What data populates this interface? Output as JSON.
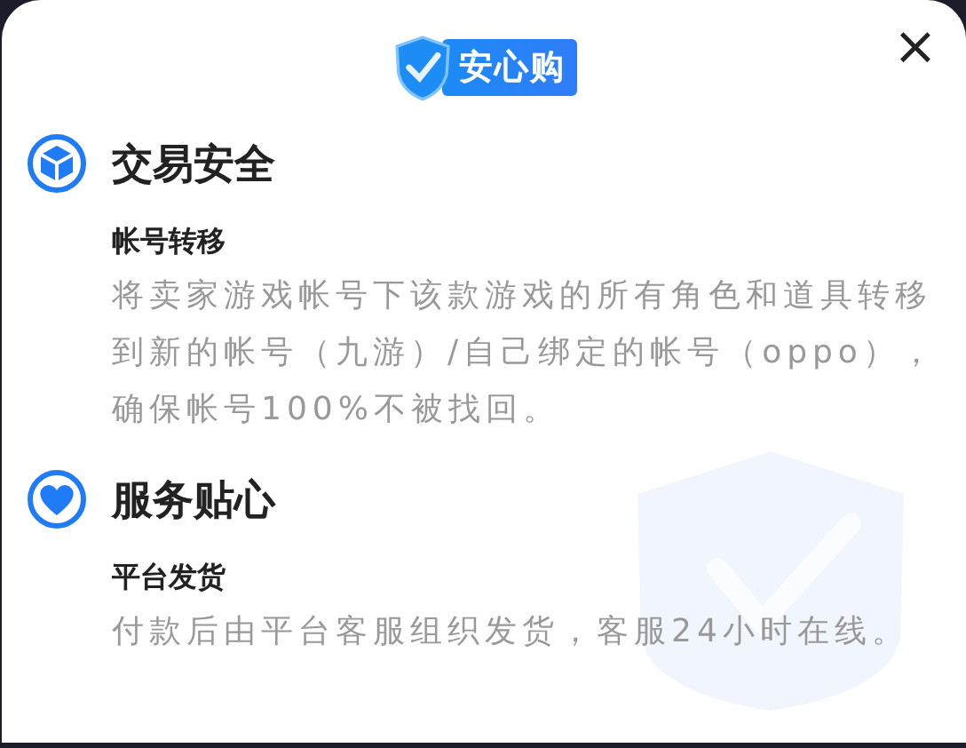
{
  "header": {
    "badge": "安心购",
    "close": "×"
  },
  "sections": [
    {
      "kind": "cube",
      "title": "交易安全",
      "subtitle": "帐号转移",
      "description": "将卖家游戏帐号下该款游戏的所有角色和道具转移到新的帐号（九游）/自己绑定的帐号（oppo），确保帐号100%不被找回。"
    },
    {
      "kind": "heart",
      "title": "服务贴心",
      "subtitle": "平台发货",
      "description": "付款后由平台客服组织发货，客服24小时在线。"
    }
  ]
}
